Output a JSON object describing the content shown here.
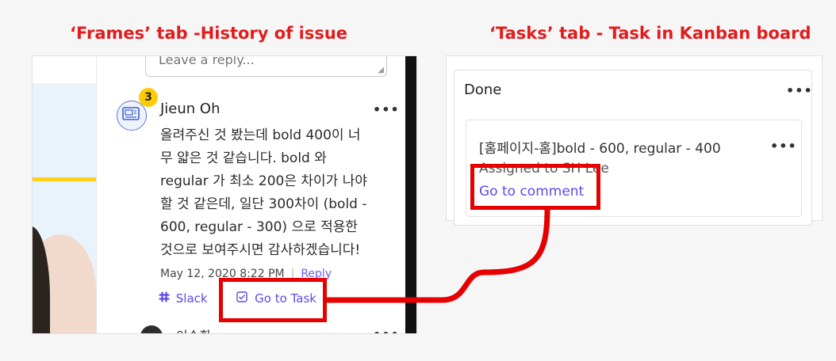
{
  "captions": {
    "left": "‘Frames’ tab -History of issue",
    "right": "‘Tasks’ tab - Task in Kanban board"
  },
  "frames_panel": {
    "reply_placeholder": "Leave a reply...",
    "comment": {
      "badge_count": "3",
      "author": "Jieun Oh",
      "more": "•••",
      "body_lines": [
        "올려주신 것 봤는데 bold 400이 너",
        "무 얇은 것 같습니다. bold 와",
        "regular 가 최소 200은 차이가 나야",
        "할 것 같은데, 일단 300차이 (bold -",
        "600, regular - 300) 으로 적용한",
        "것으로 보여주시면 감사하겠습니다!"
      ],
      "timestamp": "May 12, 2020 8:22 PM",
      "reply_label": "Reply",
      "slack_label": "Slack",
      "go_to_task_label": "Go to Task"
    },
    "next_comment_author": "이승환",
    "next_more": "•••"
  },
  "tasks_panel": {
    "column_title": "Done",
    "column_more": "•••",
    "task": {
      "title": "[홈페이지-홈]bold - 600, regular - 400",
      "more": "•••",
      "assigned": "Assigned to SH Lee",
      "go_to_comment_label": "Go to comment"
    }
  },
  "colors": {
    "highlight": "#e60000",
    "link": "#5b4be8",
    "badge": "#ffcb05"
  }
}
